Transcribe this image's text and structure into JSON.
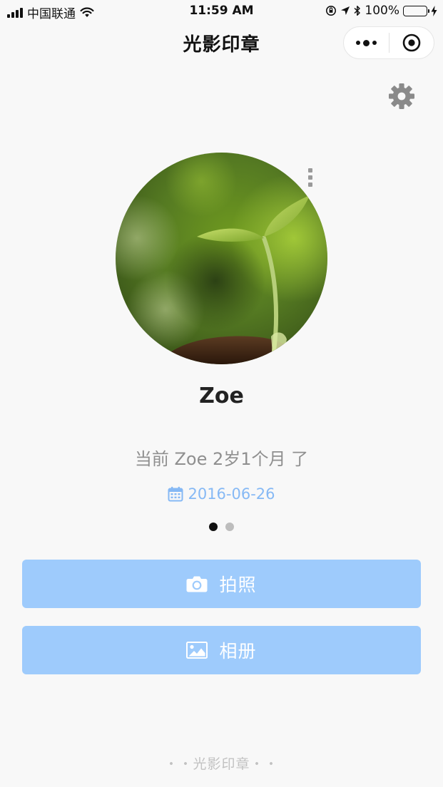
{
  "status_bar": {
    "carrier": "中国联通",
    "time": "11:59 AM",
    "battery_percent": "100%",
    "battery_level": 1.0
  },
  "nav": {
    "title": "光影印章"
  },
  "profile": {
    "name": "Zoe",
    "age_text": "当前 Zoe 2岁1个月 了",
    "birth_date": "2016-06-26"
  },
  "pager": {
    "count": 2,
    "active_index": 0
  },
  "buttons": {
    "camera_label": "拍照",
    "album_label": "相册"
  },
  "footer": {
    "text": "・・光影印章・・"
  },
  "colors": {
    "button_bg": "#9ecbfc",
    "date_accent": "#86b9f5",
    "page_bg": "#f8f8f8"
  },
  "icons": {
    "settings": "gear-icon",
    "camera": "camera-icon",
    "album": "image-icon",
    "calendar": "calendar-icon",
    "capsule_more": "more-dots-icon",
    "capsule_close": "target-circle-icon"
  }
}
